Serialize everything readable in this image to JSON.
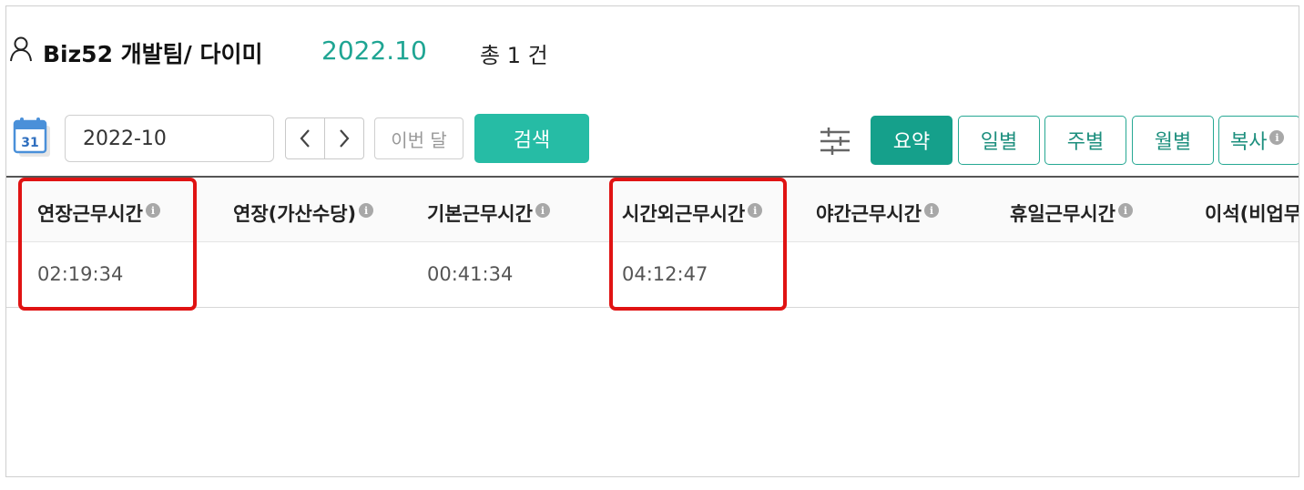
{
  "header": {
    "user": "Biz52 개발팀/ 다이미",
    "month": "2022.10",
    "count": "총 1 건"
  },
  "toolbar": {
    "month_input_value": "2022-10",
    "prev_label": "‹",
    "next_label": "›",
    "this_month_label": "이번 달",
    "search_label": "검색",
    "calendar_day": "31",
    "views": {
      "summary": "요약",
      "daily": "일별",
      "weekly": "주별",
      "monthly": "월별"
    },
    "copy_label": "복사",
    "active_view": "summary",
    "accent_color": "#26bca5"
  },
  "table": {
    "columns": [
      {
        "label": "연장근무시간",
        "info": "i"
      },
      {
        "label": "연장(가산수당)",
        "info": "i"
      },
      {
        "label": "기본근무시간",
        "info": "i"
      },
      {
        "label": "시간외근무시간",
        "info": "i"
      },
      {
        "label": "야간근무시간",
        "info": "i"
      },
      {
        "label": "휴일근무시간",
        "info": "i"
      },
      {
        "label": "이석(비업무"
      }
    ],
    "rows": [
      [
        "02:19:34",
        "",
        "00:41:34",
        "04:12:47",
        "",
        "",
        ""
      ]
    ]
  },
  "highlight_color": "#e01313"
}
